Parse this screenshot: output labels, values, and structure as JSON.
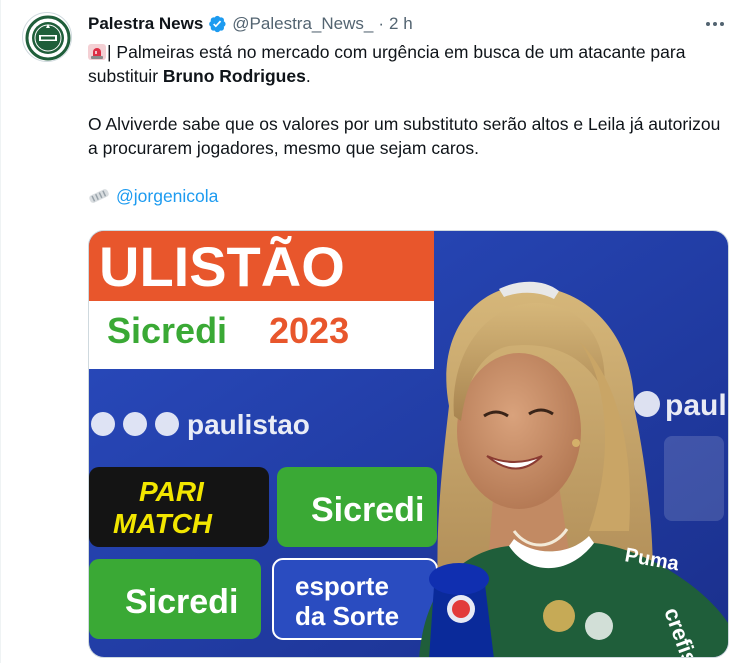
{
  "tweet": {
    "display_name": "Palestra News",
    "handle": "@Palestra_News_",
    "separator": "·",
    "timestamp": "2 h",
    "line1_prefix": "| Palmeiras está no mercado com urgência em busca de um atacante para substituir ",
    "line1_bold": "Bruno Rodrigues",
    "line1_suffix": ".",
    "paragraph2": "O Alviverde sabe que os valores por um substituto serão altos e Leila já autorizou a procurarem jogadores, mesmo que sejam caros.",
    "mention": "@jorgenicola"
  },
  "media": {
    "board_top_text": "ULISTÃO",
    "board_sicredi": "Sicredi",
    "board_year": "2023",
    "social_handle": "paulistao",
    "social_handle_right": "pauli",
    "sponsor_pari": "PARI",
    "sponsor_match": "MATCH",
    "sponsor_sicredi_1": "Sicredi",
    "sponsor_sicredi_2": "Sicredi",
    "sponsor_esporte": "esporte",
    "sponsor_sorte": "da Sorte",
    "shirt_brand_1": "Puma",
    "shirt_sponsor": "crefisa"
  },
  "colors": {
    "verified": "#1d9bf0",
    "link": "#1d9bf0",
    "muted": "#536471",
    "board_blue": "#1e3fae",
    "board_orange": "#e8562c",
    "sicredi_green": "#3aa935",
    "jersey_green": "#1f5e3a"
  },
  "icons": {
    "verified": "verified-badge-icon",
    "more": "more-options-icon",
    "siren": "rotating-light-emoji",
    "newspaper": "rolled-newspaper-emoji"
  }
}
